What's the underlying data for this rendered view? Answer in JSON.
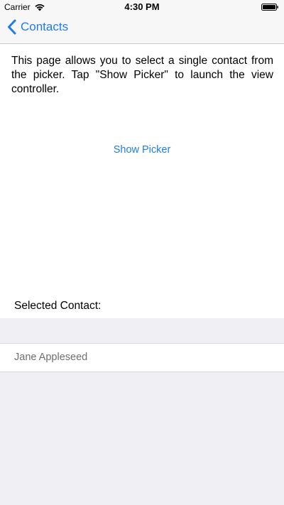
{
  "status_bar": {
    "carrier": "Carrier",
    "time": "4:30 PM",
    "wifi_icon": "wifi-icon",
    "battery_icon": "battery-icon"
  },
  "nav": {
    "back_label": "Contacts",
    "back_icon": "chevron-left-icon"
  },
  "content": {
    "description": "This page allows you to select a single contact from the picker. Tap \"Show Picker\" to launch the view controller.",
    "show_picker_label": "Show Picker",
    "selected_label": "Selected Contact:"
  },
  "selected_contact": {
    "name": "Jane Appleseed"
  },
  "colors": {
    "accent": "#1e7cf0",
    "bar_background": "#f7f7f7",
    "grouped_background": "#efeff4",
    "secondary_text": "#6d6d72"
  }
}
